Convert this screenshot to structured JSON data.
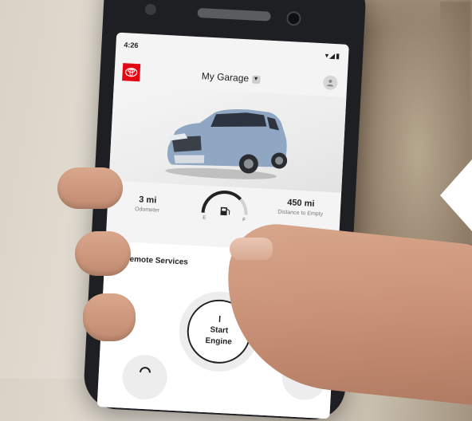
{
  "status_bar": {
    "time": "4:26",
    "icons": "▾◢▮"
  },
  "header": {
    "title": "My Garage",
    "dropdown_icon": "chevron-down-icon",
    "profile_icon": "person-icon",
    "logo": "toyota-logo"
  },
  "stats": {
    "odometer_value": "3 mi",
    "odometer_label": "Odometer",
    "fuel_empty": "E",
    "fuel_full": "F",
    "fuel_icon": "fuel-pump-icon",
    "fuel_level": 0.75,
    "distance_value": "450 mi",
    "distance_label": "Distance to Empty"
  },
  "remote": {
    "title": "Remote Services",
    "start_line1": "Start",
    "start_line2": "Engine",
    "power_icon": "power-icon",
    "lock_icon": "lock-icon",
    "unlock_icon": "unlock-icon"
  },
  "colors": {
    "brand_red": "#e30613",
    "screen_bg": "#f4f4f4",
    "car_blue": "#8fa7c2"
  }
}
